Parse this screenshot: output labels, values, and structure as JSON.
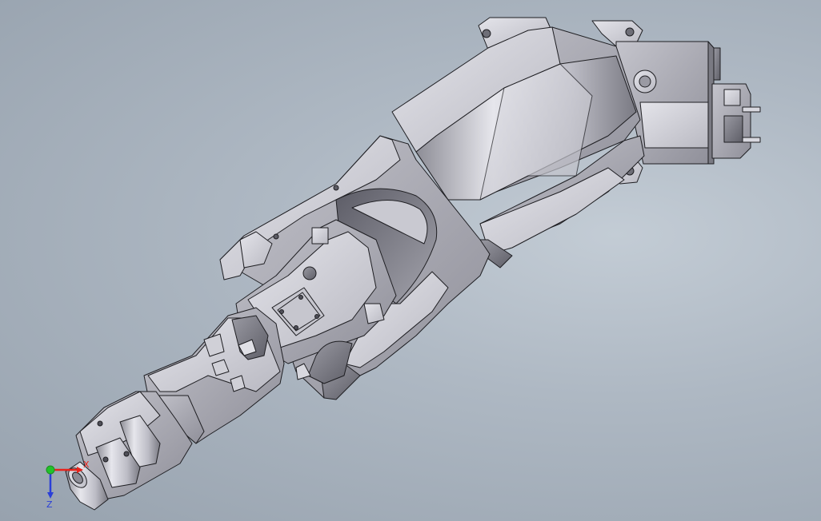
{
  "triad": {
    "x_label": "X",
    "z_label": "Z",
    "x_color": "#e8231b",
    "y_color": "#22c22a",
    "z_color": "#2a3fd8"
  },
  "colors": {
    "background": "#aeb8c3",
    "part_light": "#d9d9e0",
    "part_mid": "#b3b3bb",
    "part_dark": "#7d7d86",
    "edge": "#1e1e22"
  }
}
